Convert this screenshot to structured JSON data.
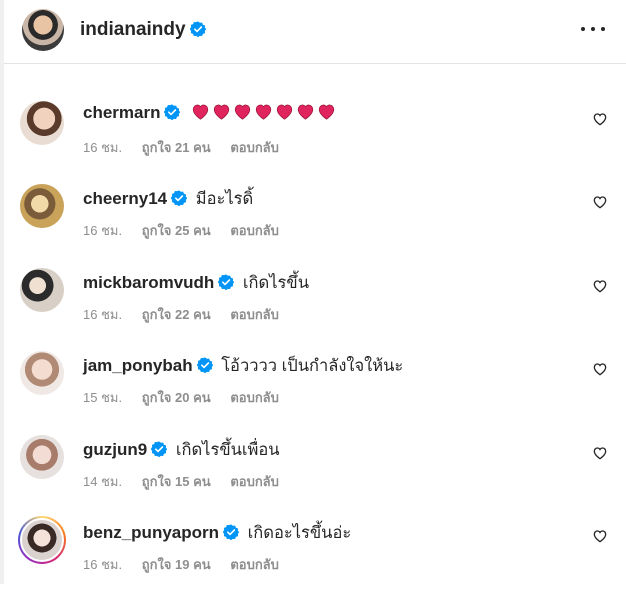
{
  "post_author": {
    "username": "indianaindy",
    "verified": true
  },
  "comments": [
    {
      "username": "chermarn",
      "text": "",
      "heart_emoji_count": 7,
      "time": "16 ชม.",
      "likes": "ถูกใจ 21 คน",
      "reply": "ตอบกลับ"
    },
    {
      "username": "cheerny14",
      "text": "มีอะไรดิ้",
      "time": "16 ชม.",
      "likes": "ถูกใจ 25 คน",
      "reply": "ตอบกลับ"
    },
    {
      "username": "mickbaromvudh",
      "text": "เกิดไรขึ้น",
      "time": "16 ชม.",
      "likes": "ถูกใจ 22 คน",
      "reply": "ตอบกลับ"
    },
    {
      "username": "jam_ponybah",
      "text": "โอ้วววว เป็นกำลังใจให้นะ",
      "time": "15 ชม.",
      "likes": "ถูกใจ 20 คน",
      "reply": "ตอบกลับ"
    },
    {
      "username": "guzjun9",
      "text": "เกิดไรขึ้นเพื่อน",
      "time": "14 ชม.",
      "likes": "ถูกใจ 15 คน",
      "reply": "ตอบกลับ"
    },
    {
      "username": "benz_punyaporn",
      "text": "เกิดอะไรขึ้นอ่ะ",
      "time": "16 ชม.",
      "likes": "ถูกใจ 19 คน",
      "reply": "ตอบกลับ"
    }
  ],
  "colors": {
    "verified": "#0095f6",
    "heart_emoji": "#e0245e",
    "meta_text": "#8e8e8e"
  },
  "icons": {
    "more": "more-options-icon",
    "like": "heart-outline-icon",
    "verified": "verified-badge-icon"
  }
}
